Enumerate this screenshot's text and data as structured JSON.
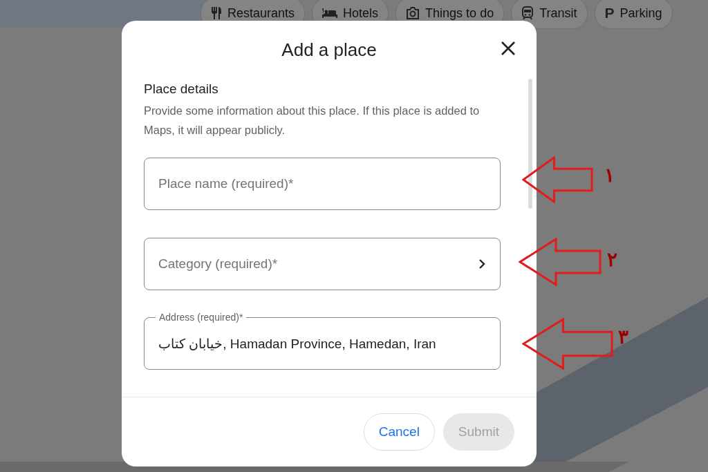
{
  "map_chips": [
    {
      "label": "Restaurants",
      "kind": "restaurant"
    },
    {
      "label": "Hotels",
      "kind": "hotel"
    },
    {
      "label": "Things to do",
      "kind": "camera"
    },
    {
      "label": "Transit",
      "kind": "transit"
    },
    {
      "label": "Parking",
      "kind": "glyph",
      "glyph": "P"
    }
  ],
  "dialog": {
    "title": "Add a place",
    "section_title": "Place details",
    "description": "Provide some information about this place. If this place is added to Maps, it will appear publicly.",
    "fields": [
      {
        "kind": "text",
        "placeholder": "Place name (required)*"
      },
      {
        "kind": "select",
        "placeholder": "Category (required)*"
      },
      {
        "kind": "filled",
        "label": "Address (required)*",
        "value": "خیابان کتاب, Hamadan Province, Hamedan, Iran"
      }
    ],
    "buttons": [
      {
        "label": "Cancel",
        "disabled": false
      },
      {
        "label": "Submit",
        "disabled": true
      }
    ]
  },
  "annotations": [
    {
      "label": "۱"
    },
    {
      "label": "۲"
    },
    {
      "label": "۳"
    }
  ]
}
